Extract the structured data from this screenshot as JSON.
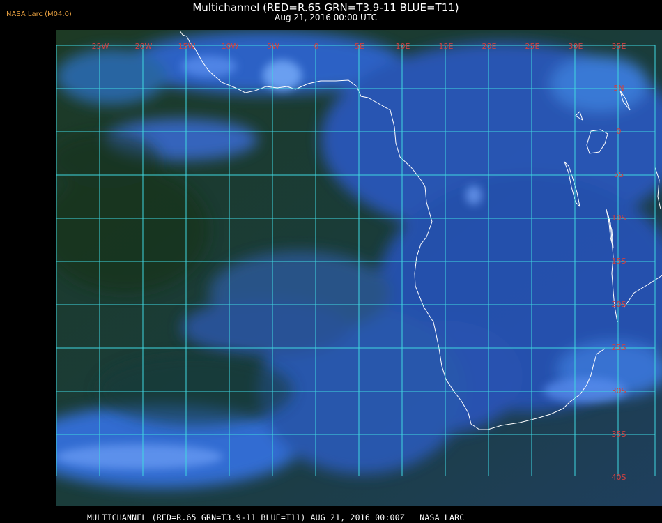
{
  "header": {
    "provider": "NASA Larc (M04.0)",
    "title": "Multichannel (RED=R.65 GRN=T3.9-11 BLUE=T11)",
    "datetime": "Aug 21, 2016 00:00 UTC"
  },
  "footer": {
    "caption": "MULTICHANNEL (RED=R.65 GRN=T3.9-11 BLUE=T11) AUG 21, 2016 00:00Z   NASA LARC"
  },
  "map": {
    "longitude_labels": [
      "25W",
      "20W",
      "15W",
      "10W",
      "5W",
      "0",
      "5E",
      "10E",
      "15E",
      "20E",
      "25E",
      "30E",
      "35E"
    ],
    "latitude_labels": [
      "5N",
      "0",
      "5S",
      "10S",
      "15S",
      "20S",
      "25S",
      "30S",
      "35S",
      "40S"
    ],
    "colors": {
      "grid": "#3fd7e0",
      "grid_label": "#d04040",
      "coastline": "#ffffff",
      "ocean_green": "#17331c",
      "cloud_blue": "#2e62d8"
    }
  }
}
